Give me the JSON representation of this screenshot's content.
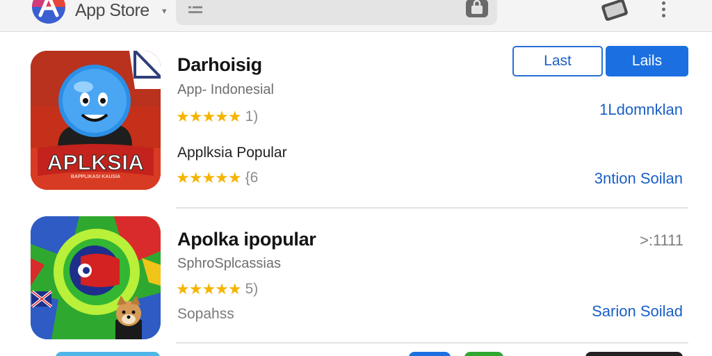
{
  "header": {
    "brand": "App Store",
    "brand_caret": "▾",
    "logo_icon": "app-store-logo",
    "search_icon": "list-icon",
    "bag_icon": "shopping-bag-icon",
    "cast_icon": "cast-icon",
    "menu_icon": "more-vert-icon"
  },
  "apps": [
    {
      "title": "Darhoisig",
      "subtitle": "App- Indonesial",
      "stars": "★★★★★",
      "rating_count": "1)",
      "secondary_title": "Applksia Popular",
      "secondary_stars": "★★★★★",
      "secondary_count": "{6",
      "link_top": "1Ldomnklan",
      "link_bottom": "3ntion Soilan",
      "button_outline": "Last",
      "button_solid": "Lails",
      "icon_text": "APLKSIA",
      "icon_small_text": "BAPPLIKASI KAUSIA"
    },
    {
      "title": "Apolka ipopular",
      "subtitle": "SphroSplcassias",
      "stars": "★★★★★",
      "rating_count": "5)",
      "secondary_title": "Sopahss",
      "more_label": ">:1111",
      "link_bottom": "Sarion Soilad"
    }
  ],
  "colors": {
    "accent": "#1b6fe0",
    "link": "#1a5fc7",
    "star": "#f5b400",
    "icon1_bg": "#c8331c",
    "icon2_green": "#2fa82f"
  }
}
